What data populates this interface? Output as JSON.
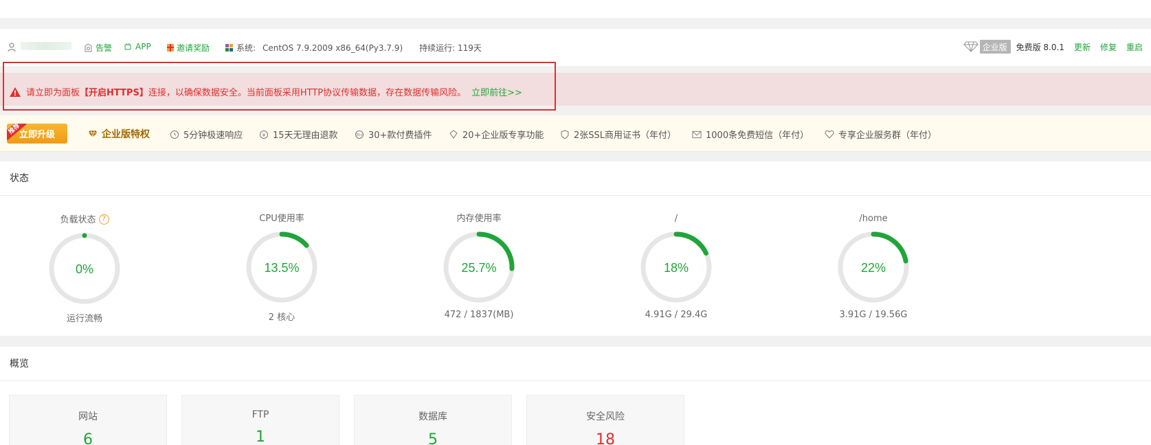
{
  "header": {
    "alarm": "告警",
    "app": "APP",
    "invite": "邀请奖励",
    "system_label": "系统:",
    "system_value": "CentOS 7.9.2009 x86_64(Py3.7.9)",
    "uptime": "持续运行: 119天",
    "enterprise_badge": "企业版",
    "edition": "免费版 8.0.1",
    "update": "更新",
    "repair": "修复",
    "restart": "重启"
  },
  "warning": {
    "prefix": "请立即为面板",
    "highlight": "【开启HTTPS】",
    "suffix": "连接，以确保数据安全。当前面板采用HTTP协议传输数据，存在数据传输风险。",
    "link": "立即前往>>"
  },
  "enterprise_bar": {
    "recommend_tag": "推荐",
    "upgrade_button": "立即升级",
    "title": "企业版特权",
    "features": [
      "5分钟极速响应",
      "15天无理由退款",
      "30+款付费插件",
      "20+企业版专享功能",
      "2张SSL商用证书（年付）",
      "1000条免费短信（年付）",
      "专享企业服务群（年付）"
    ]
  },
  "status": {
    "title": "状态",
    "help_icon": "?",
    "gauges": [
      {
        "label": "负载状态",
        "value": "0%",
        "percent": 0,
        "sub": "运行流畅"
      },
      {
        "label": "CPU使用率",
        "value": "13.5%",
        "percent": 13.5,
        "sub": "2 核心"
      },
      {
        "label": "内存使用率",
        "value": "25.7%",
        "percent": 25.7,
        "sub": "472 / 1837(MB)"
      },
      {
        "label": "/",
        "value": "18%",
        "percent": 18,
        "sub": "4.91G / 29.4G"
      },
      {
        "label": "/home",
        "value": "22%",
        "percent": 22,
        "sub": "3.91G / 19.56G"
      }
    ]
  },
  "overview": {
    "title": "概览",
    "cards": [
      {
        "label": "网站",
        "value": "6",
        "color": "#20a53a"
      },
      {
        "label": "FTP",
        "value": "1",
        "color": "#20a53a"
      },
      {
        "label": "数据库",
        "value": "5",
        "color": "#20a53a"
      },
      {
        "label": "安全风险",
        "value": "18",
        "color": "#e02f2f"
      }
    ]
  },
  "colors": {
    "accent": "#20a53a",
    "danger": "#e02f2f",
    "warning_bg": "#f2dede",
    "gauge_track": "#e6e6e6"
  }
}
